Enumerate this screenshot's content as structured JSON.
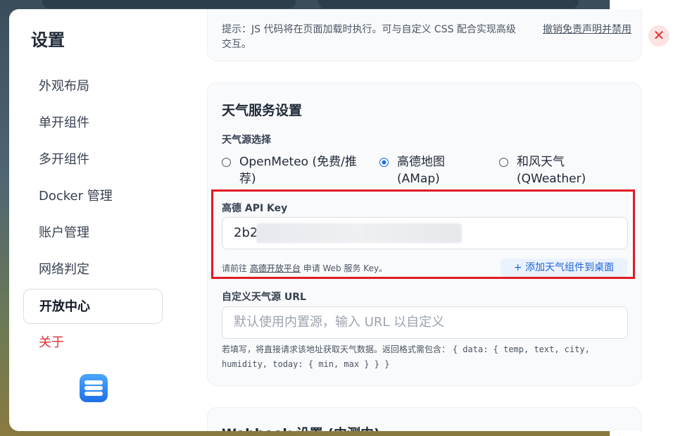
{
  "sidebar": {
    "title": "设置",
    "items": [
      {
        "label": "外观布局"
      },
      {
        "label": "单开组件"
      },
      {
        "label": "多开组件"
      },
      {
        "label": "Docker 管理"
      },
      {
        "label": "账户管理"
      },
      {
        "label": "网络判定"
      },
      {
        "label": "开放中心",
        "active": true
      },
      {
        "label": "关于",
        "color": "#e03131"
      }
    ]
  },
  "prev_card": {
    "hint": "提示：JS 代码将在页面加载时执行。可与自定义 CSS 配合实现高级交互。",
    "link": "撤销免责声明并禁用"
  },
  "weather": {
    "title": "天气服务设置",
    "source_label": "天气源选择",
    "sources": [
      {
        "label": "OpenMeteo (免费/推荐)",
        "selected": false
      },
      {
        "label": "高德地图 (AMap)",
        "selected": true
      },
      {
        "label": "和风天气 (QWeather)",
        "selected": false
      }
    ],
    "amap_key_label": "高德 API Key",
    "amap_key_value": "2b2e",
    "key_hint_prefix": "请前往",
    "key_hint_link": "高德开放平台",
    "key_hint_suffix": "申请 Web 服务 Key。",
    "add_widget_button": "+ 添加天气组件到桌面",
    "custom_url_label": "自定义天气源 URL",
    "custom_url_placeholder": "默认使用内置源，输入 URL 以自定义",
    "custom_url_hint_text": "若填写，将直接请求该地址获取天气数据。返回格式需包含：",
    "custom_url_hint_code": "{ data: { temp, text, city, humidity, today: { min, max } } }"
  },
  "webhook": {
    "title": "Webhook 设置 (内测中)"
  },
  "close_icon": "close-icon",
  "colors": {
    "accent": "#1e6fe8",
    "highlight_box": "#e01b24",
    "danger": "#e03131"
  }
}
